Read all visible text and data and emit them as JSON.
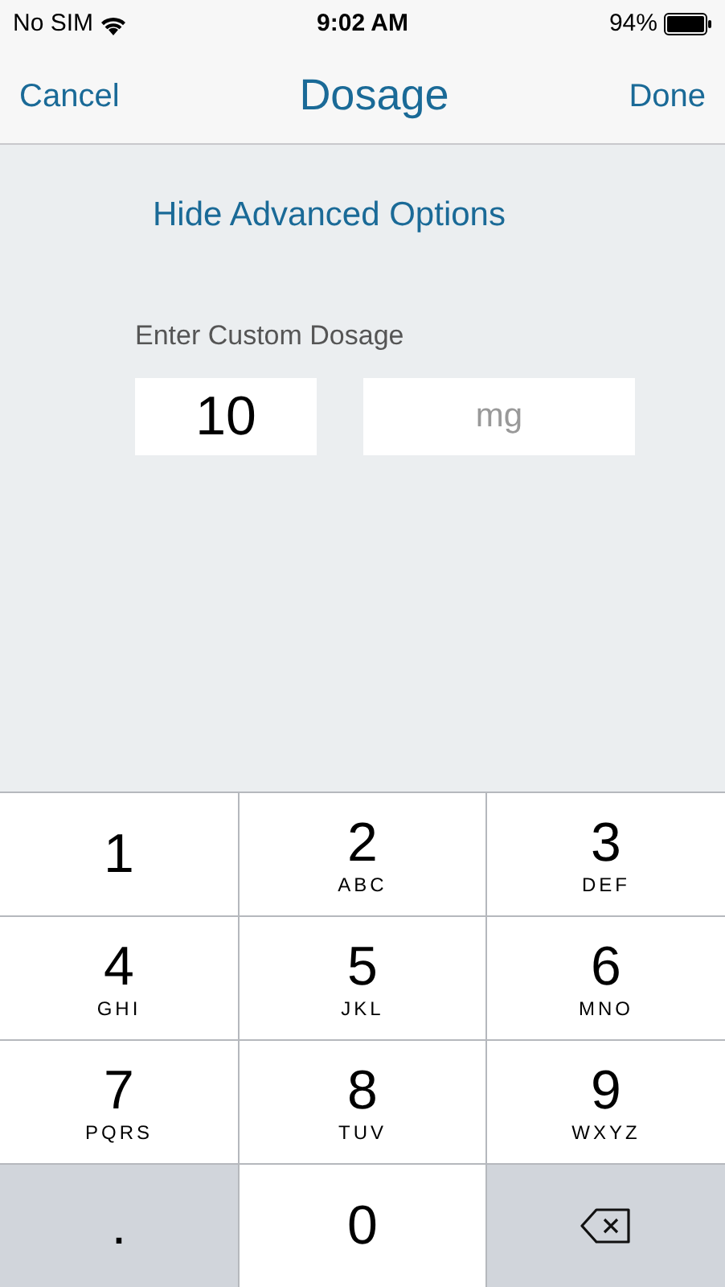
{
  "status_bar": {
    "carrier": "No SIM",
    "time": "9:02 AM",
    "battery": "94%"
  },
  "nav_bar": {
    "cancel": "Cancel",
    "title": "Dosage",
    "done": "Done"
  },
  "advanced_toggle": "Hide Advanced Options",
  "custom_dosage": {
    "label": "Enter Custom Dosage",
    "value": "10",
    "unit_placeholder": "mg"
  },
  "keypad": [
    {
      "kind": "digit",
      "digit": "1"
    },
    {
      "kind": "digit",
      "digit": "2",
      "letters": "ABC"
    },
    {
      "kind": "digit",
      "digit": "3",
      "letters": "DEF"
    },
    {
      "kind": "digit",
      "digit": "4",
      "letters": "GHI"
    },
    {
      "kind": "digit",
      "digit": "5",
      "letters": "JKL"
    },
    {
      "kind": "digit",
      "digit": "6",
      "letters": "MNO"
    },
    {
      "kind": "digit",
      "digit": "7",
      "letters": "PQRS"
    },
    {
      "kind": "digit",
      "digit": "8",
      "letters": "TUV"
    },
    {
      "kind": "digit",
      "digit": "9",
      "letters": "WXYZ"
    },
    {
      "kind": "decimal",
      "digit": "."
    },
    {
      "kind": "digit",
      "digit": "0"
    },
    {
      "kind": "delete"
    }
  ]
}
